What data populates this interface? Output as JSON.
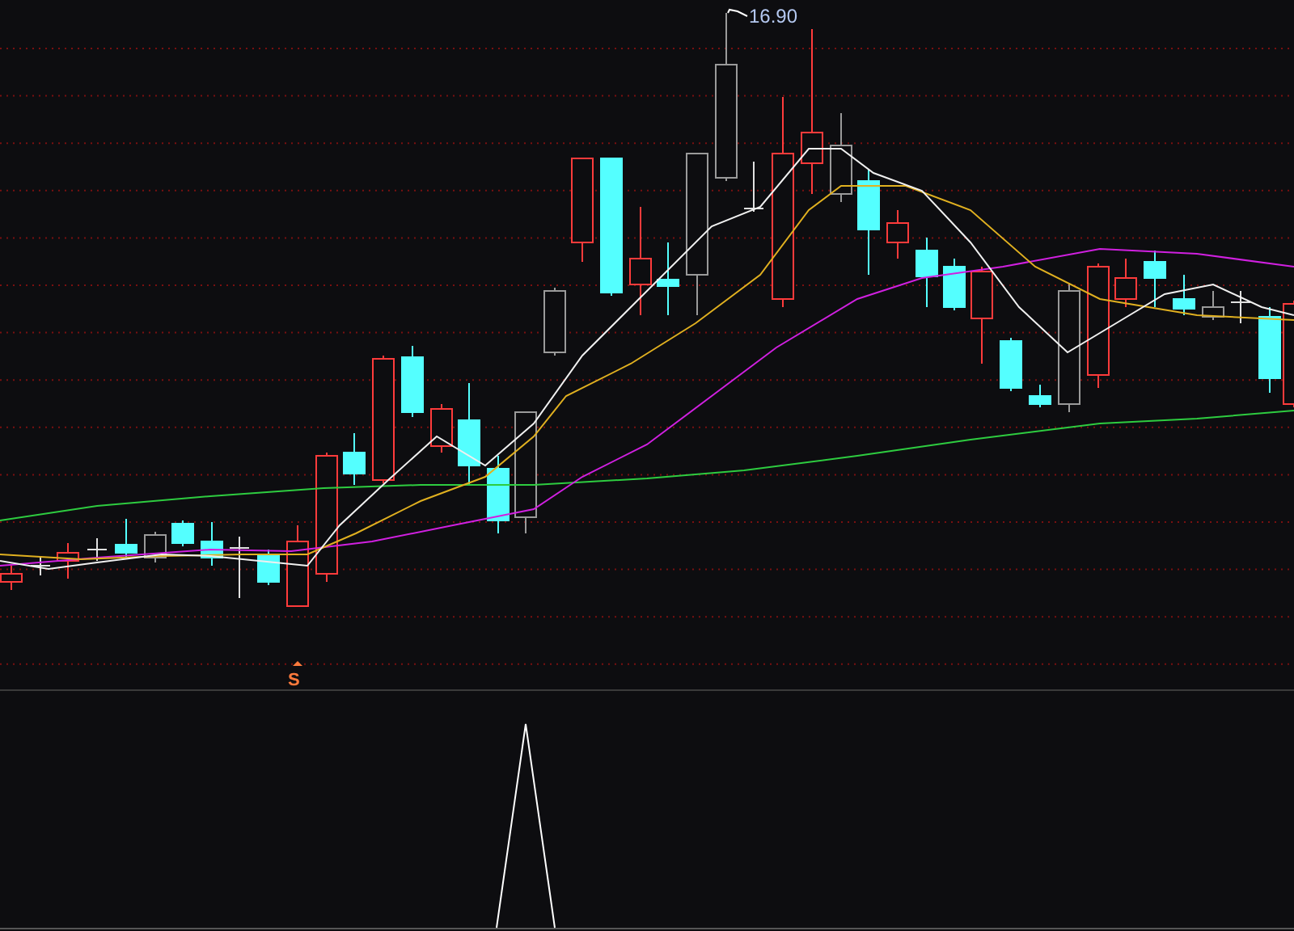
{
  "price_chart": {
    "high_label": "16.90",
    "signal_marker": "S"
  }
}
